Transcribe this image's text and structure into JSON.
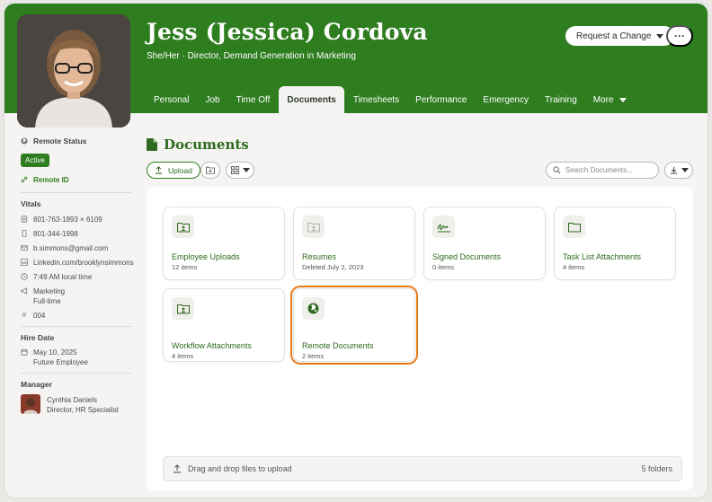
{
  "profile": {
    "name": "Jess (Jessica) Cordova",
    "subtitle": "She/Her · Director, Demand Generation in Marketing"
  },
  "actions": {
    "request_change": "Request a Change",
    "more": "···"
  },
  "tabs": [
    {
      "label": "Personal"
    },
    {
      "label": "Job"
    },
    {
      "label": "Time Off"
    },
    {
      "label": "Documents"
    },
    {
      "label": "Timesheets"
    },
    {
      "label": "Performance"
    },
    {
      "label": "Emergency"
    },
    {
      "label": "Training"
    },
    {
      "label": "More"
    }
  ],
  "sidebar": {
    "remote_status_label": "Remote Status",
    "status_badge": "Active",
    "remote_id": "Remote ID",
    "vitals_heading": "Vitals",
    "phone_office": "801-763-1893 × 6109",
    "phone_mobile": "801-344-1998",
    "email": "b.simmons@gmail.com",
    "linkedin": "Linkedin.com/brooklynsimmons",
    "local_time": "7:49 AM local time",
    "department": "Marketing",
    "employment_type": "Full-time",
    "employee_number": "004",
    "hire_heading": "Hire Date",
    "hire_date": "May 10, 2025",
    "hire_note": "Future Employee",
    "manager_heading": "Manager",
    "manager_name": "Cynthia Daniels",
    "manager_title": "Director, HR Specialist"
  },
  "documents": {
    "title": "Documents",
    "upload_label": "Upload",
    "search_placeholder": "Search Documents...",
    "folders": [
      {
        "name": "Employee Uploads",
        "meta": "12 items",
        "icon": "folder-upload-icon"
      },
      {
        "name": "Resumes",
        "meta": "Deleted July 2, 2023",
        "icon": "folder-upload-icon"
      },
      {
        "name": "Signed Documents",
        "meta": "0 items",
        "icon": "signature-icon"
      },
      {
        "name": "Task List Attachments",
        "meta": "4 items",
        "icon": "folder-icon"
      },
      {
        "name": "Workflow Attachments",
        "meta": "4 items",
        "icon": "folder-upload-icon"
      },
      {
        "name": "Remote Documents",
        "meta": "2 items",
        "icon": "globe-icon"
      }
    ],
    "dropzone_label": "Drag and drop files to upload",
    "folder_count": "5 folders"
  },
  "colors": {
    "brand": "#2e7d1f",
    "selection": "#e8791a"
  }
}
